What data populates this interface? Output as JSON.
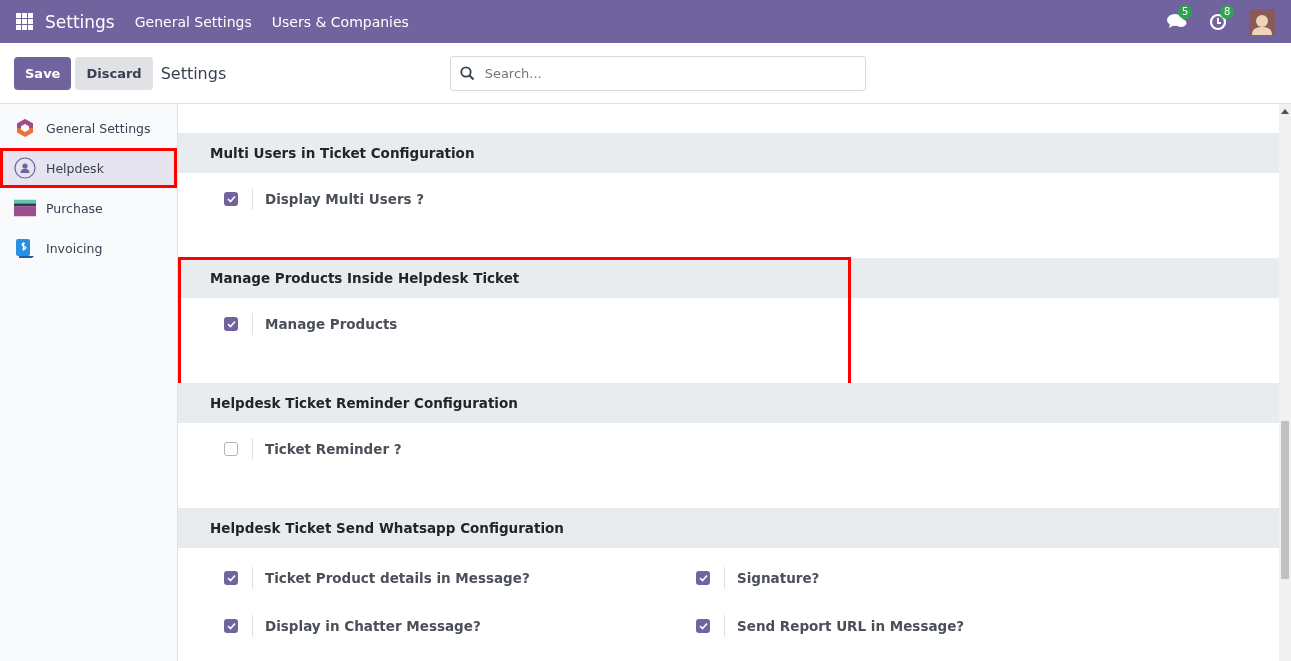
{
  "navbar": {
    "app_title": "Settings",
    "menu": [
      "General Settings",
      "Users & Companies"
    ],
    "messages_badge": "5",
    "activities_badge": "8"
  },
  "control_panel": {
    "buttons": [
      {
        "label": "Save",
        "kind": "primary"
      },
      {
        "label": "Discard",
        "kind": "secondary"
      }
    ],
    "breadcrumb": "Settings",
    "search": {
      "placeholder": "Search..."
    }
  },
  "sidebar": {
    "items": [
      {
        "label": "General Settings",
        "selected": false,
        "highlighted": false
      },
      {
        "label": "Helpdesk",
        "selected": true,
        "highlighted": true
      },
      {
        "label": "Purchase",
        "selected": false,
        "highlighted": false
      },
      {
        "label": "Invoicing",
        "selected": false,
        "highlighted": false
      }
    ]
  },
  "sections": [
    {
      "title": "Multi Users in Ticket Configuration",
      "highlighted": false,
      "settings": [
        {
          "label": "Display Multi Users ?",
          "checked": true
        }
      ]
    },
    {
      "title": "Manage Products Inside Helpdesk Ticket",
      "highlighted": true,
      "settings": [
        {
          "label": "Manage Products",
          "checked": true
        }
      ]
    },
    {
      "title": "Helpdesk Ticket Reminder Configuration",
      "highlighted": false,
      "settings": [
        {
          "label": "Ticket Reminder ?",
          "checked": false
        }
      ]
    },
    {
      "title": "Helpdesk Ticket Send Whatsapp Configuration",
      "highlighted": false,
      "settings": [
        {
          "label": "Ticket Product details in Message?",
          "checked": true
        },
        {
          "label": "Signature?",
          "checked": true
        },
        {
          "label": "Display in Chatter Message?",
          "checked": true
        },
        {
          "label": "Send Report URL in Message?",
          "checked": true
        }
      ]
    }
  ]
}
